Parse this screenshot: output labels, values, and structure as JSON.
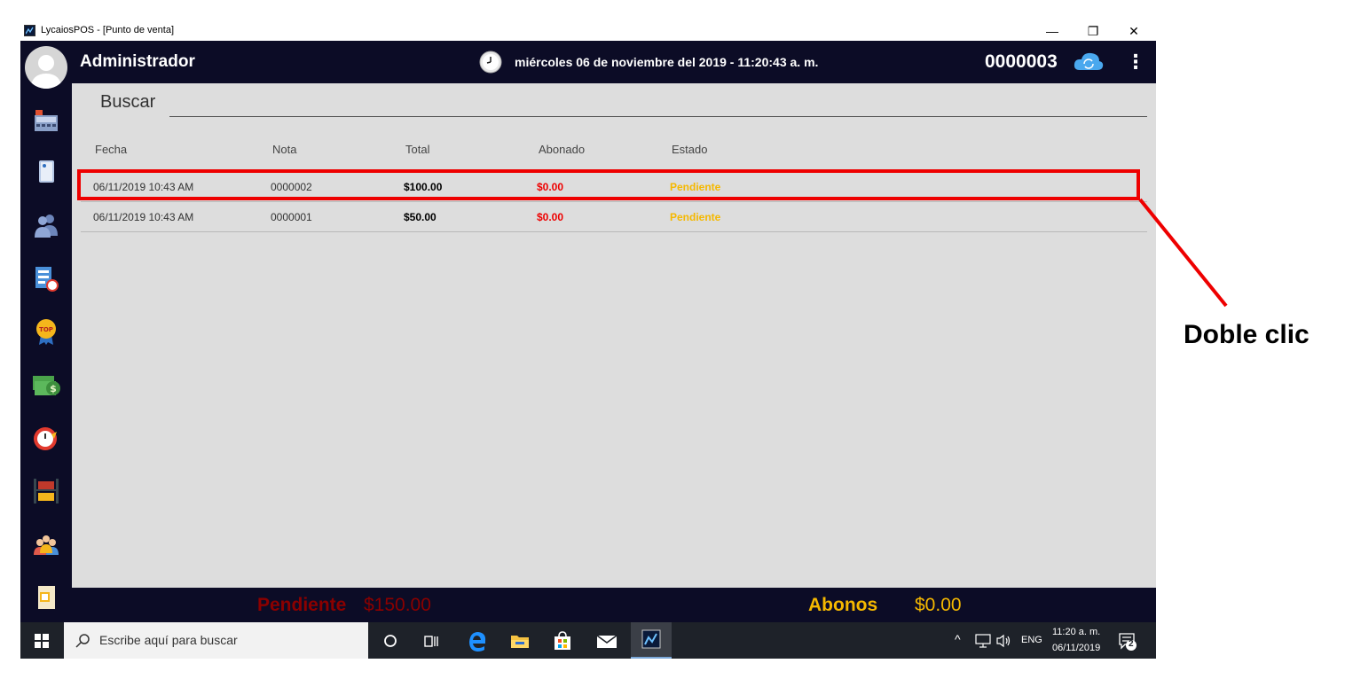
{
  "window": {
    "title": "LycaiosPOS - [Punto de venta]",
    "minimize": "—",
    "restore": "❐",
    "close": "✕"
  },
  "header": {
    "user": "Administrador",
    "datetime": "miércoles 06 de noviembre del 2019 - 11:20:43 a. m.",
    "note_number": "0000003",
    "menu_glyph": "⋮"
  },
  "sidebar": {
    "icons": [
      "cash-register-icon",
      "notebook-icon",
      "users-icon",
      "report-clock-icon",
      "top-badge-icon",
      "money-icon",
      "timer-icon",
      "inventory-shelf-icon",
      "customers-icon",
      "document-icon"
    ]
  },
  "search": {
    "label": "Buscar"
  },
  "table": {
    "columns": [
      "Fecha",
      "Nota",
      "Total",
      "Abonado",
      "Estado"
    ],
    "rows": [
      {
        "fecha": "06/11/2019 10:43 AM",
        "nota": "0000002",
        "total": "$100.00",
        "abonado": "$0.00",
        "estado": "Pendiente"
      },
      {
        "fecha": "06/11/2019 10:43 AM",
        "nota": "0000001",
        "total": "$50.00",
        "abonado": "$0.00",
        "estado": "Pendiente"
      }
    ]
  },
  "footer": {
    "pending_label": "Pendiente",
    "pending_value": "$150.00",
    "payments_label": "Abonos",
    "payments_value": "$0.00"
  },
  "taskbar": {
    "search_placeholder": "Escribe aquí para buscar",
    "language": "ENG",
    "time": "11:20 a. m.",
    "date": "06/11/2019",
    "notification_count": "2",
    "tray_up": "^"
  },
  "annotation": {
    "text": "Doble clic"
  },
  "colors": {
    "header_bg": "#0c0c26",
    "main_bg": "#dddddd",
    "amount_red": "#ee0000",
    "status_orange": "#f5b800",
    "pending_dark_red": "#8b0000",
    "abonos_yellow": "#f5b800",
    "highlight_red": "#ee0000"
  }
}
